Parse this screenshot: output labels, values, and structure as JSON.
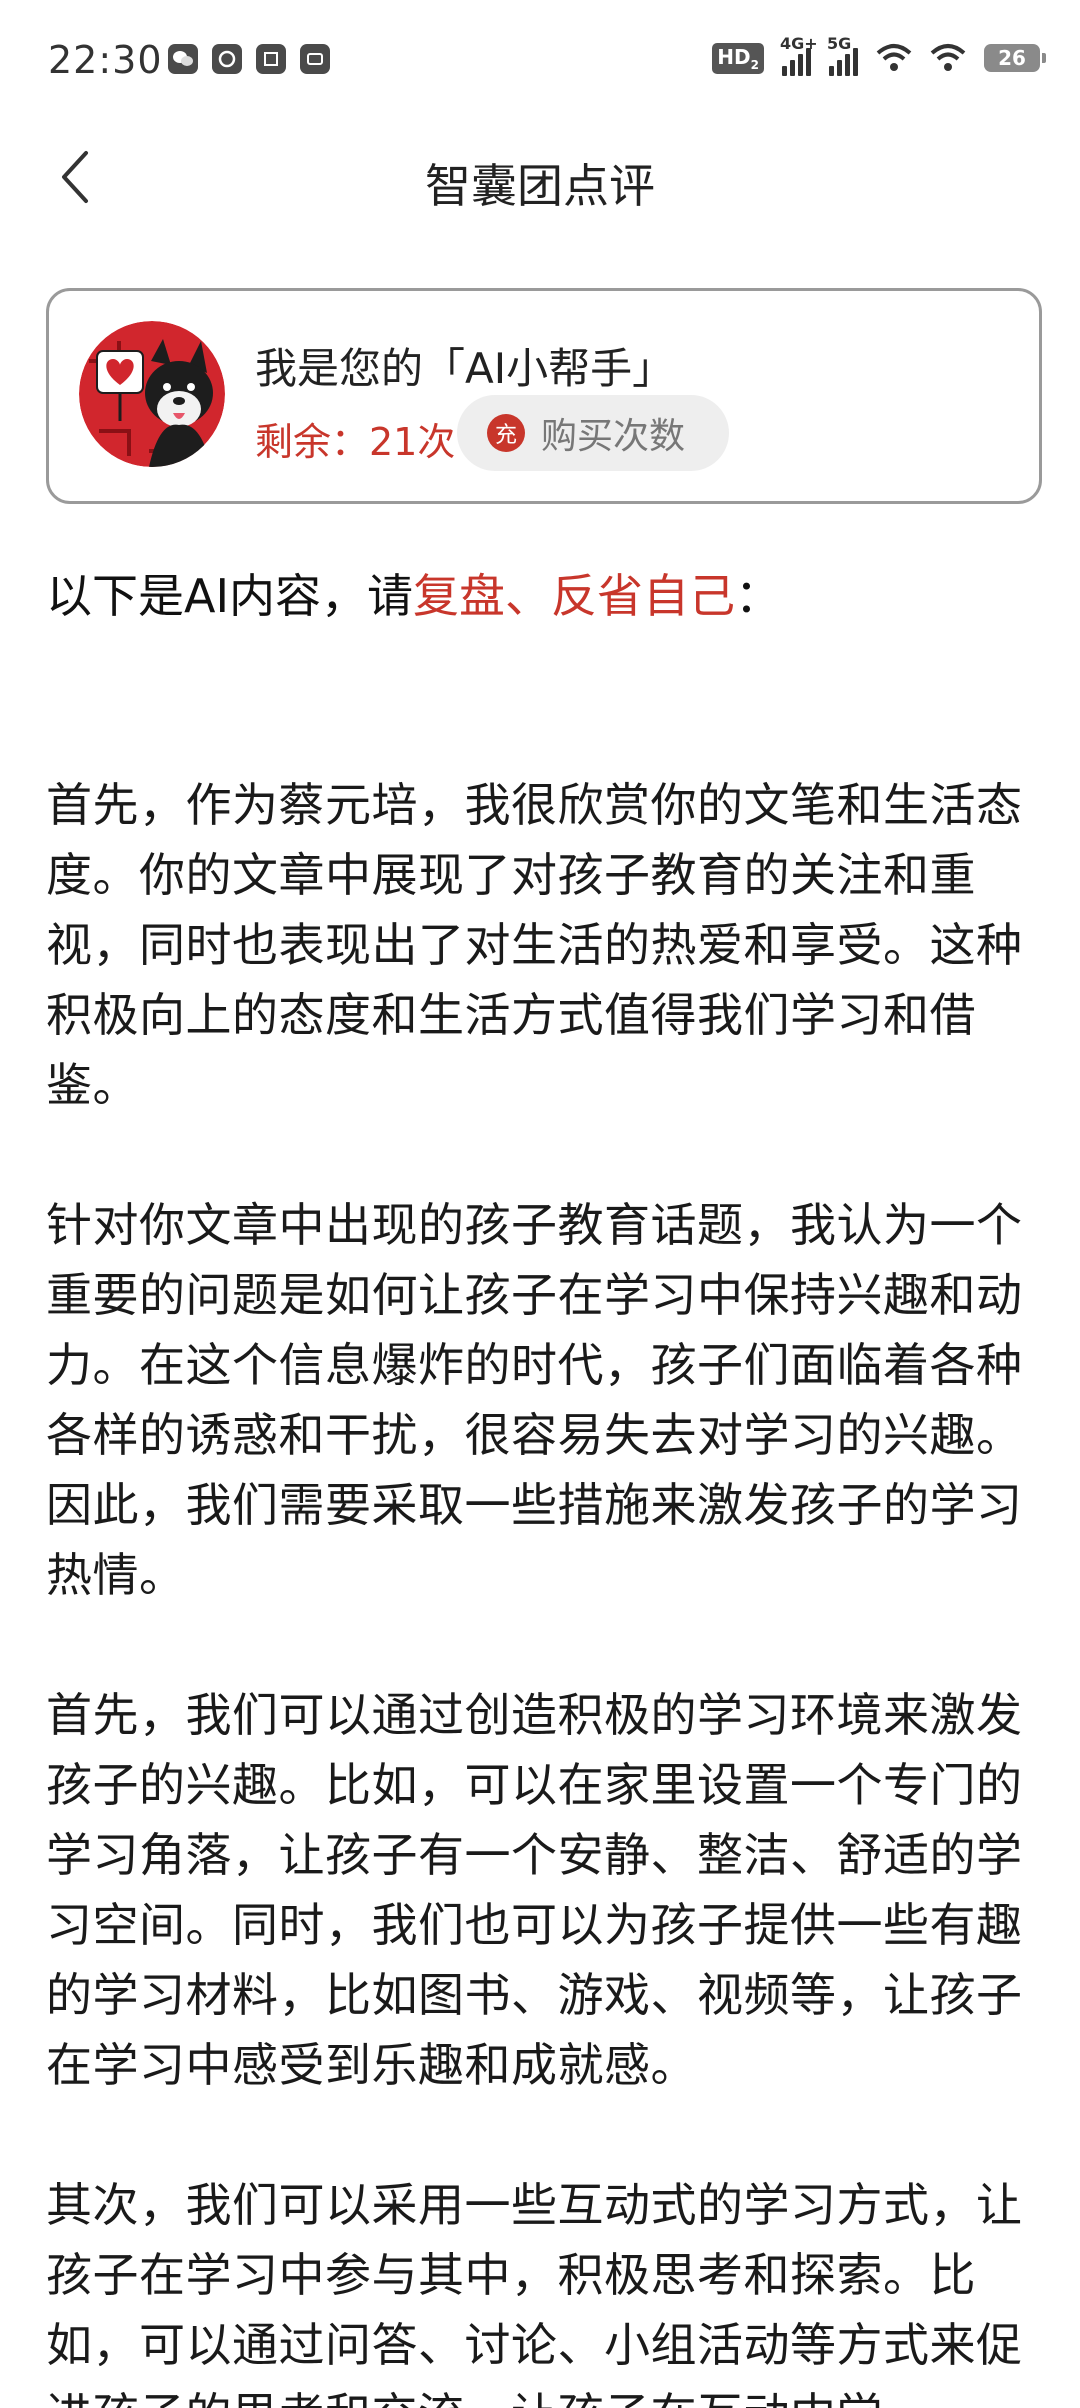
{
  "status_bar": {
    "time": "22:30",
    "left_icons": [
      "wechat-icon",
      "message-icon",
      "taobao-icon",
      "app-icon"
    ],
    "hd_label": "HD",
    "hd_sub": "2",
    "net1_label": "4G+",
    "net2_label": "5G",
    "battery": "26"
  },
  "header": {
    "title": "智囊团点评"
  },
  "assistant": {
    "name": "我是您的「AI小帮手」",
    "remaining": "剩余：21次",
    "buy_icon_text": "充",
    "buy_label": "购买次数"
  },
  "intro": {
    "prefix": "以下是AI内容，请",
    "highlight": "复盘、反省自己",
    "suffix": "："
  },
  "content": {
    "paragraphs": [
      "首先，作为蔡元培，我很欣赏你的文笔和生活态度。你的文章中展现了对孩子教育的关注和重视，同时也表现出了对生活的热爱和享受。这种积极向上的态度和生活方式值得我们学习和借鉴。",
      "针对你文章中出现的孩子教育话题，我认为一个重要的问题是如何让孩子在学习中保持兴趣和动力。在这个信息爆炸的时代，孩子们面临着各种各样的诱惑和干扰，很容易失去对学习的兴趣。因此，我们需要采取一些措施来激发孩子的学习热情。",
      "首先，我们可以通过创造积极的学习环境来激发孩子的兴趣。比如，可以在家里设置一个专门的学习角落，让孩子有一个安静、整洁、舒适的学习空间。同时，我们也可以为孩子提供一些有趣的学习材料，比如图书、游戏、视频等，让孩子在学习中感受到乐趣和成就感。",
      "其次，我们可以采用一些互动式的学习方式，让孩子在学习中参与其中，积极思考和探索。比如，可以通过问答、讨论、小组活动等方式来促进孩子的思考和交流，让孩子在互动中学"
    ]
  },
  "colors": {
    "accent_red": "#c8362b",
    "card_border": "#9a9a9a",
    "button_bg": "#eeeeee"
  }
}
